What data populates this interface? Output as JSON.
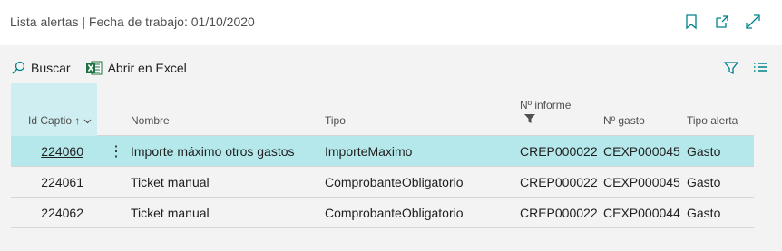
{
  "window": {
    "title": "Lista alertas | Fecha de trabajo: 01/10/2020",
    "icons": [
      "bookmark-icon",
      "open-in-new-window-icon",
      "expand-icon"
    ]
  },
  "toolbar": {
    "search_label": "Buscar",
    "excel_label": "Abrir en Excel",
    "right_icons": [
      "filter-icon",
      "list-view-icon"
    ]
  },
  "table": {
    "columns": {
      "id": "Id Captio",
      "nombre": "Nombre",
      "tipo": "Tipo",
      "informe": "Nº informe",
      "gasto": "Nº gasto",
      "tipo_alerta": "Tipo alerta"
    },
    "sort_indicator": "↑",
    "rows": [
      {
        "id": "224060",
        "nombre": "Importe máximo otros gastos",
        "tipo": "ImporteMaximo",
        "informe": "CREP000022",
        "gasto": "CEXP000045",
        "tipo_alerta": "Gasto"
      },
      {
        "id": "224061",
        "nombre": "Ticket manual",
        "tipo": "ComprobanteObligatorio",
        "informe": "CREP000022",
        "gasto": "CEXP000045",
        "tipo_alerta": "Gasto"
      },
      {
        "id": "224062",
        "nombre": "Ticket manual",
        "tipo": "ComprobanteObligatorio",
        "informe": "CREP000022",
        "gasto": "CEXP000044",
        "tipo_alerta": "Gasto"
      }
    ],
    "selected_row_index": 0
  },
  "colors": {
    "accent": "#00838a",
    "selected_row": "#b5e8eb",
    "sorted_header": "#cfeef2",
    "excel_green": "#1e7145"
  }
}
